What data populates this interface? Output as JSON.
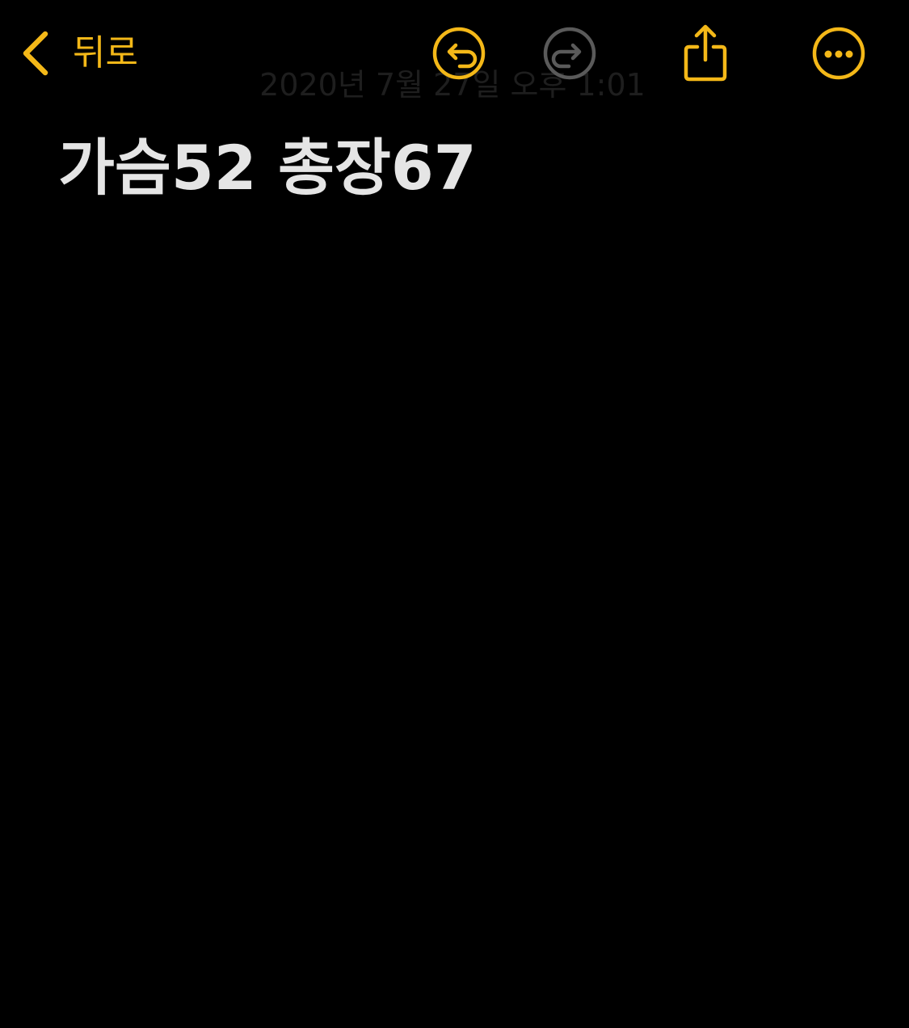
{
  "toolbar": {
    "back_label": "뒤로",
    "back_icon": "chevron-left-icon",
    "undo_icon": "undo-circle-icon",
    "redo_icon": "redo-circle-icon",
    "share_icon": "share-icon",
    "more_icon": "ellipsis-circle-icon",
    "redo_enabled": false
  },
  "note": {
    "date": "2020년 7월 27일 오후 1:01",
    "body": "가슴52 총장67"
  },
  "colors": {
    "accent": "#f4b818",
    "disabled": "#5a5a5a",
    "background": "#000000",
    "text": "#e5e5e5"
  }
}
